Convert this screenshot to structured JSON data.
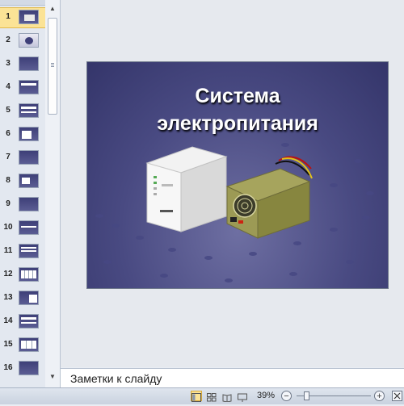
{
  "slide": {
    "title_line1": "Система",
    "title_line2": "электропитания"
  },
  "thumbnails": {
    "numbers": [
      "1",
      "2",
      "3",
      "4",
      "5",
      "6",
      "7",
      "8",
      "9",
      "10",
      "11",
      "12",
      "13",
      "14",
      "15",
      "16"
    ],
    "selected": "1"
  },
  "notes": {
    "placeholder": "Заметки к слайду"
  },
  "statusbar": {
    "zoom_label": "39%",
    "zoom_minus": "−",
    "zoom_plus": "+"
  },
  "colors": {
    "slide_background": "#494a82",
    "selection": "#fbe396",
    "title_text": "#ffffff"
  }
}
